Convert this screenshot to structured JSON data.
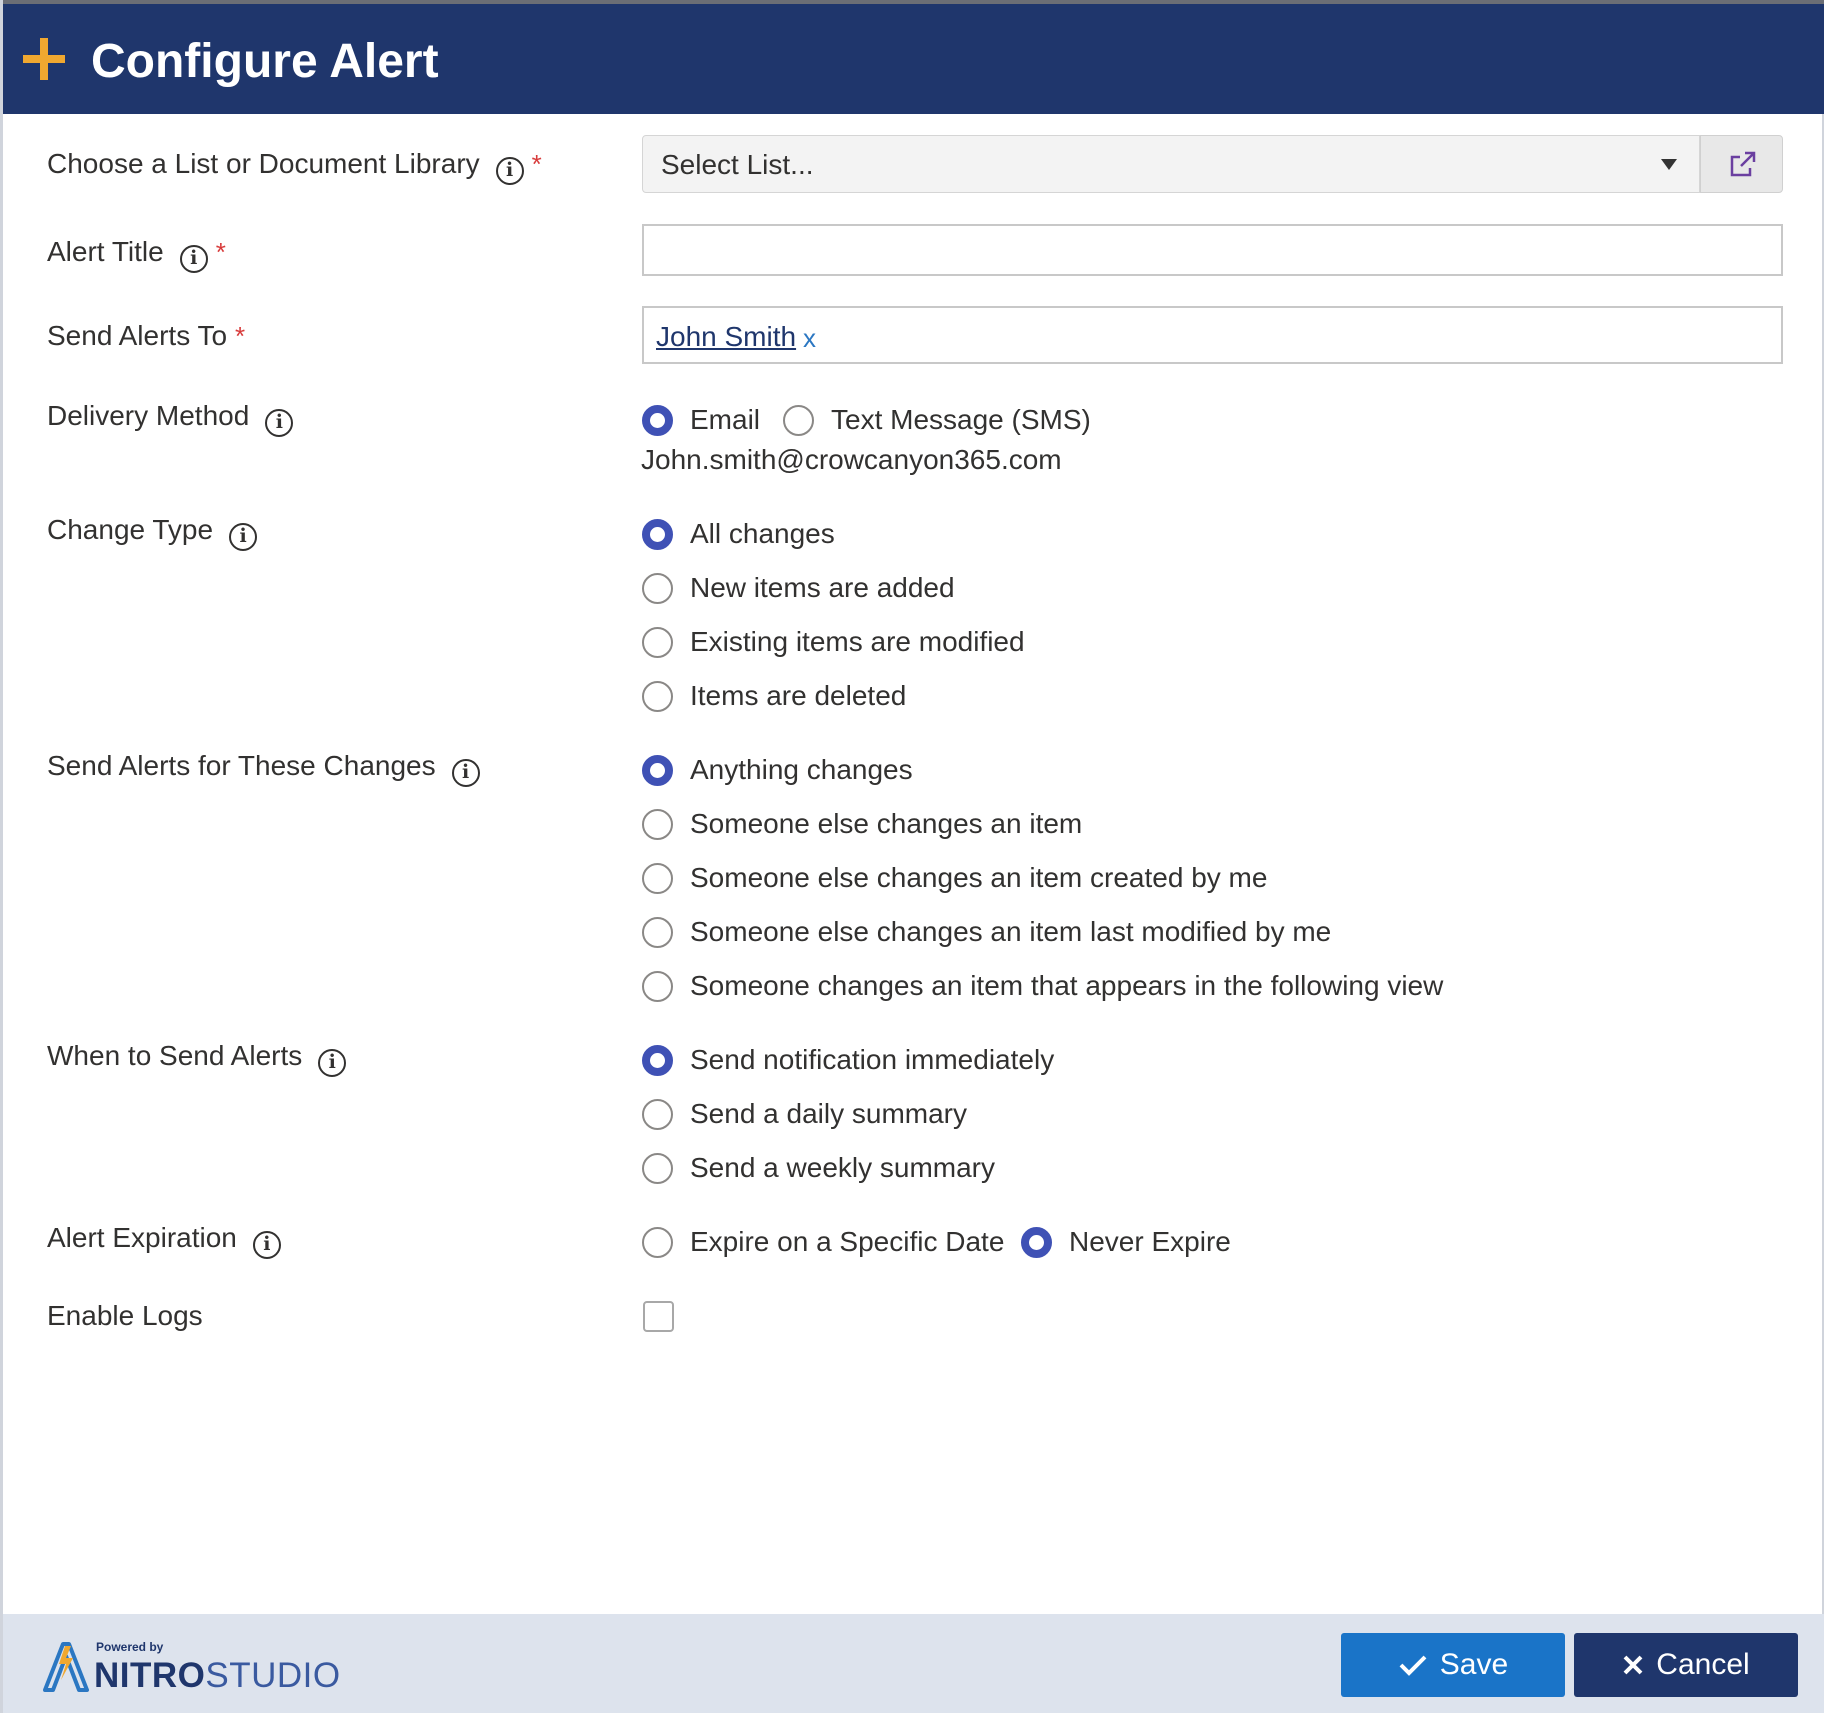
{
  "header": {
    "title": "Configure Alert",
    "icon": "plus-icon",
    "accent": "#f0a830",
    "bg": "#1f366c"
  },
  "fields": {
    "list": {
      "label": "Choose a List or Document Library",
      "placeholder": "Select List...",
      "required": "*"
    },
    "title": {
      "label": "Alert Title",
      "value": "",
      "required": "*"
    },
    "send_to": {
      "label": "Send Alerts To",
      "required": "*",
      "person": "John Smith",
      "remove": "x"
    },
    "delivery": {
      "label": "Delivery Method",
      "options": [
        "Email",
        "Text Message (SMS)"
      ],
      "selected": "Email",
      "email": "John.smith@crowcanyon365.com"
    },
    "change_type": {
      "label": "Change Type",
      "options": [
        "All changes",
        "New items are added",
        "Existing items are modified",
        "Items are deleted"
      ],
      "selected": "All changes"
    },
    "changes_filter": {
      "label": "Send Alerts for These Changes",
      "options": [
        "Anything changes",
        "Someone else changes an item",
        "Someone else changes an item created by me",
        "Someone else changes an item last modified by me",
        "Someone changes an item that appears in the following view"
      ],
      "selected": "Anything changes"
    },
    "when": {
      "label": "When to Send Alerts",
      "options": [
        "Send notification immediately",
        "Send a daily summary",
        "Send a weekly summary"
      ],
      "selected": "Send notification immediately"
    },
    "expiration": {
      "label": "Alert Expiration",
      "options": [
        "Expire on a Specific Date",
        "Never Expire"
      ],
      "selected": "Never Expire"
    },
    "logs": {
      "label": "Enable Logs",
      "checked": false
    }
  },
  "footer": {
    "powered_by": "Powered by",
    "brand_bold": "NITRO",
    "brand_light": "STUDIO",
    "save_label": "Save",
    "cancel_label": "Cancel"
  },
  "colors": {
    "accent": "#3f51b5",
    "save": "#1a74c8",
    "cancel": "#1f366c",
    "required": "#d83b3b"
  }
}
